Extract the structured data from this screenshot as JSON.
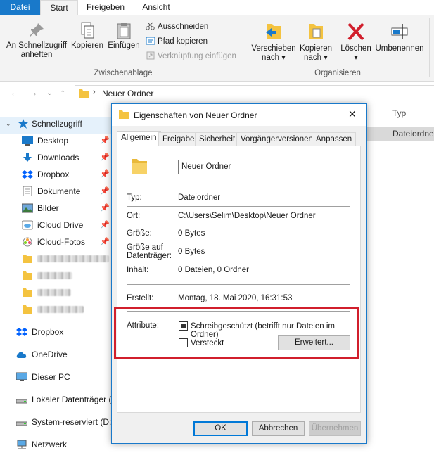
{
  "ribbon_tabs": [
    "Datei",
    "Start",
    "Freigeben",
    "Ansicht"
  ],
  "ribbon": {
    "pin_label_1": "An Schnellzugriff",
    "pin_label_2": "anheften",
    "copy_label": "Kopieren",
    "paste_label": "Einfügen",
    "cut_label": "Ausschneiden",
    "copy_path_label": "Pfad kopieren",
    "paste_shortcut_label": "Verknüpfung einfügen",
    "clipboard_group": "Zwischenablage",
    "move_label_1": "Verschieben",
    "move_label_2": "nach ▾",
    "copyto_label_1": "Kopieren",
    "copyto_label_2": "nach ▾",
    "delete_label_1": "Löschen",
    "delete_label_2": "▾",
    "rename_label": "Umbenennen",
    "organize_group": "Organisieren"
  },
  "address": {
    "path": "Neuer Ordner",
    "separator": "›"
  },
  "file_list": {
    "column_type": "Typ",
    "selected_type": "Dateiordner"
  },
  "nav": {
    "quick_access": "Schnellzugriff",
    "items": [
      {
        "label": "Desktop",
        "pinned": true
      },
      {
        "label": "Downloads",
        "pinned": true
      },
      {
        "label": "Dropbox",
        "pinned": true
      },
      {
        "label": "Dokumente",
        "pinned": true
      },
      {
        "label": "Bilder",
        "pinned": true
      },
      {
        "label": "iCloud Drive",
        "pinned": true
      },
      {
        "label": "iCloud-Fotos",
        "pinned": true
      }
    ],
    "pin_glyph": "📌",
    "roots": [
      {
        "label": "Dropbox"
      },
      {
        "label": "OneDrive"
      },
      {
        "label": "Dieser PC"
      },
      {
        "label": "Lokaler Datenträger ("
      },
      {
        "label": "System-reserviert (D:)"
      },
      {
        "label": "Netzwerk"
      }
    ]
  },
  "dialog": {
    "title": "Eigenschaften von Neuer Ordner",
    "close": "✕",
    "tabs": [
      "Allgemein",
      "Freigabe",
      "Sicherheit",
      "Vorgängerversionen",
      "Anpassen"
    ],
    "name_value": "Neuer Ordner",
    "type_label": "Typ:",
    "type_value": "Dateiordner",
    "location_label": "Ort:",
    "location_value": "C:\\Users\\Selim\\Desktop\\Neuer Ordner",
    "size_label": "Größe:",
    "size_value": "0 Bytes",
    "size_on_disk_label_1": "Größe auf",
    "size_on_disk_label_2": "Datenträger:",
    "size_on_disk_value": "0 Bytes",
    "contents_label": "Inhalt:",
    "contents_value": "0 Dateien, 0 Ordner",
    "created_label": "Erstellt:",
    "created_value": "Montag, 18. Mai 2020, 16:31:53",
    "attributes_label": "Attribute:",
    "readonly_label": "Schreibgeschützt (betrifft nur Dateien im Ordner)",
    "hidden_label": "Versteckt",
    "advanced_button": "Erweitert...",
    "ok_button": "OK",
    "cancel_button": "Abbrechen",
    "apply_button": "Übernehmen"
  },
  "colors": {
    "accent": "#1979ca",
    "highlight": "#d11f2c"
  }
}
